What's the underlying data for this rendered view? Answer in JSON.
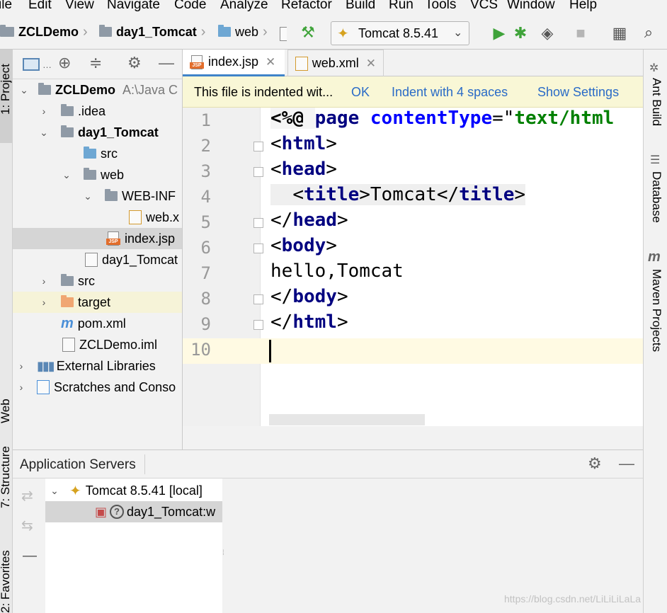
{
  "menu": [
    "ile",
    "Edit",
    "View",
    "Navigate",
    "Code",
    "Analyze",
    "Refactor",
    "Build",
    "Run",
    "Tools",
    "VCS",
    "Window",
    "Help"
  ],
  "breadcrumb": {
    "project": "ZCLDemo",
    "module": "day1_Tomcat",
    "folder": "web"
  },
  "run_config": {
    "label": "Tomcat 8.5.41"
  },
  "left_stripe": {
    "project": "1: Project",
    "web": "Web",
    "structure": "7: Structure",
    "favorites": "2: Favorites"
  },
  "right_stripe": {
    "ant": "Ant Build",
    "database": "Database",
    "maven": "Maven Projects"
  },
  "project_tree": [
    {
      "label": "ZCLDemo",
      "extra": "A:\\Java C"
    },
    {
      "label": ".idea"
    },
    {
      "label": "day1_Tomcat"
    },
    {
      "label": "src"
    },
    {
      "label": "web"
    },
    {
      "label": "WEB-INF"
    },
    {
      "label": "web.x"
    },
    {
      "label": "index.jsp"
    },
    {
      "label": "day1_Tomcat"
    },
    {
      "label": "src"
    },
    {
      "label": "target"
    },
    {
      "label": "pom.xml"
    },
    {
      "label": "ZCLDemo.iml"
    },
    {
      "label": "External Libraries"
    },
    {
      "label": "Scratches and Conso"
    }
  ],
  "tabs": [
    {
      "label": "index.jsp",
      "jsp_tag": "JSP"
    },
    {
      "label": "web.xml"
    }
  ],
  "notification": {
    "message": "This file is indented wit...",
    "ok": "OK",
    "indent": "Indent with 4 spaces",
    "settings": "Show Settings"
  },
  "line_numbers": [
    "1",
    "2",
    "3",
    "4",
    "5",
    "6",
    "7",
    "8",
    "9",
    "10"
  ],
  "code": {
    "l1_open": "<%@ ",
    "l1_page": "page",
    "l1_space": " ",
    "l1_attr": "contentType",
    "l1_eq": "=\"",
    "l1_str": "text/html",
    "l2_lt": "<",
    "l2_tag": "html",
    "l2_gt": ">",
    "l3_lt": "<",
    "l3_tag": "head",
    "l3_gt": ">",
    "l4_indent": "  ",
    "l4_lt": "<",
    "l4_tag": "title",
    "l4_gt": ">",
    "l4_text": "Tomcat",
    "l4_lt2": "</",
    "l4_tag2": "title",
    "l4_gt2": ">",
    "l5_lt": "</",
    "l5_tag": "head",
    "l5_gt": ">",
    "l6_lt": "<",
    "l6_tag": "body",
    "l6_gt": ">",
    "l7_text": "hello,Tomcat",
    "l8_lt": "</",
    "l8_tag": "body",
    "l8_gt": ">",
    "l9_lt": "</",
    "l9_tag": "html",
    "l9_gt": ">"
  },
  "app_servers": {
    "title": "Application Servers",
    "server": "Tomcat 8.5.41 [local]",
    "artifact": "day1_Tomcat:w"
  },
  "watermark": "https://blog.csdn.net/LiLiLiLaLa",
  "colors": {
    "accent": "#4083c9",
    "tag": "#000080",
    "attr": "#0000ff",
    "string": "#008000",
    "run": "#3fa33a",
    "jsp": "#e26d2b"
  }
}
